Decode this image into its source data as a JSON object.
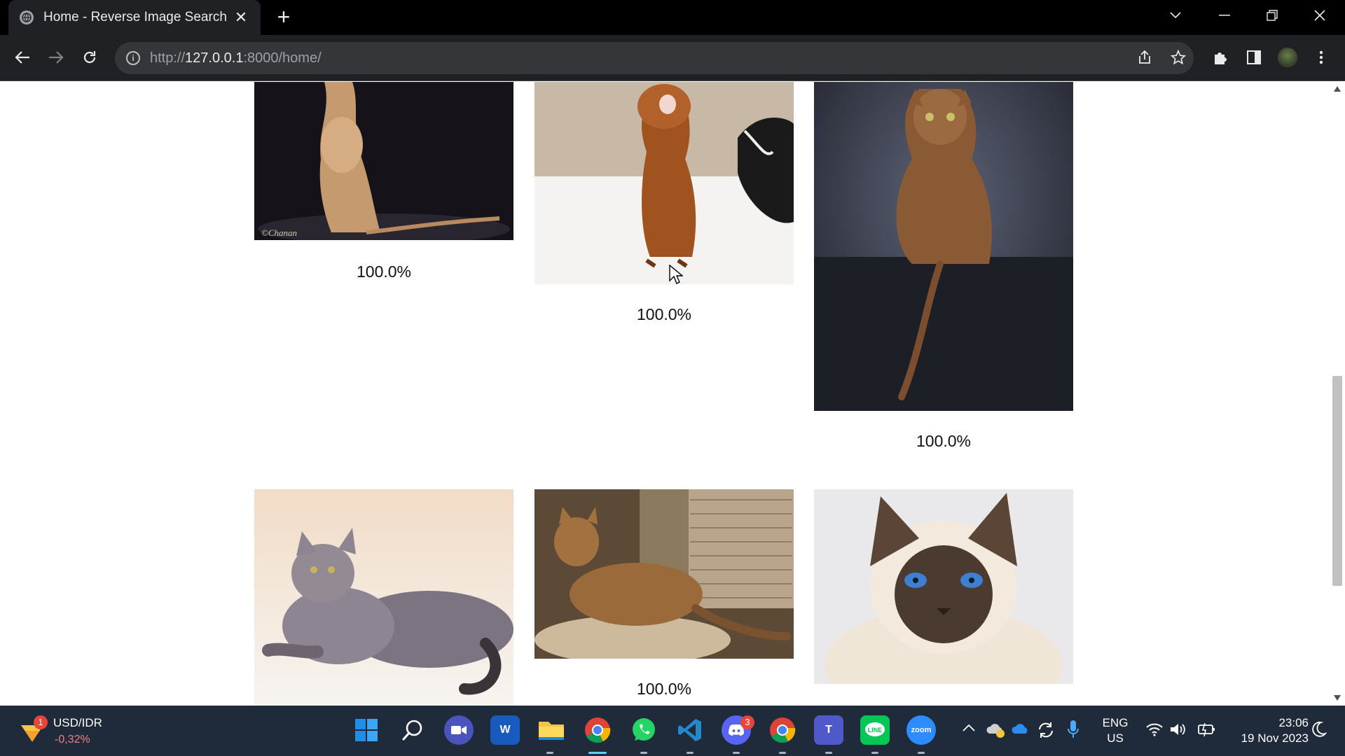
{
  "browser": {
    "tab_title": "Home - Reverse Image Search",
    "url_scheme": "http://",
    "url_host": "127.0.0.1",
    "url_path": ":8000/home/"
  },
  "results": [
    {
      "label": "100.0%",
      "description": "Ruddy cat sitting against dark backdrop",
      "signature": "©Chanan"
    },
    {
      "label": "100.0%",
      "description": "Ruddy cat sitting with mouth open on white sheet"
    },
    {
      "label": "100.0%",
      "description": "Cat seen from behind, looking back over shoulder"
    },
    {
      "label": "",
      "description": "Blue cat lying down on cream background"
    },
    {
      "label": "100.0%",
      "description": "Spotted tabby cat on a cushion indoors"
    },
    {
      "label": "",
      "description": "Seal point cat with blue eyes"
    }
  ],
  "taskbar": {
    "widget_title": "USD/IDR",
    "widget_value": "-0,32%",
    "widget_badge": "1",
    "discord_badge": "3",
    "zoom_label": "zoom",
    "lang_line1": "ENG",
    "lang_line2": "US",
    "time": "23:06",
    "date": "19 Nov 2023"
  },
  "icons": [
    "globe-icon",
    "close-icon",
    "plus-icon",
    "chevron-down-icon",
    "minimize-icon",
    "restore-icon",
    "back-arrow-icon",
    "forward-arrow-icon",
    "reload-icon",
    "info-icon",
    "share-icon",
    "star-icon",
    "puzzle-icon",
    "sidepanel-icon",
    "avatar",
    "kebab-menu-icon"
  ]
}
